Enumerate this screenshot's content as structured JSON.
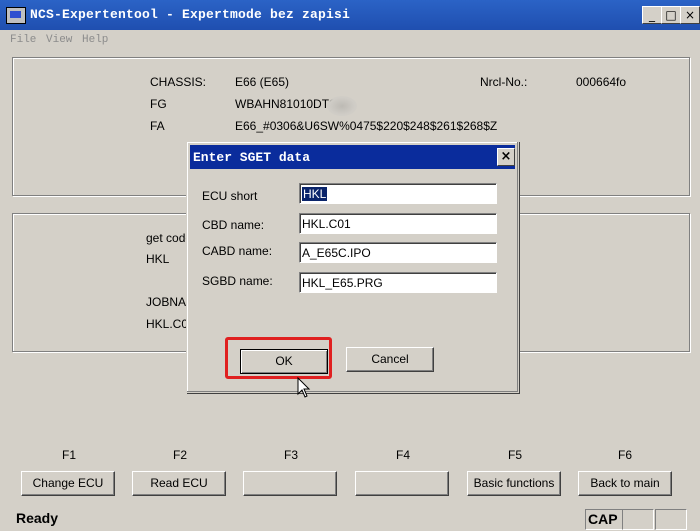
{
  "window": {
    "title": "NCS-Expertentool - Expertmode bez zapisi",
    "controls": {
      "minimize": "_",
      "maximize": "□",
      "close": "×"
    }
  },
  "menu": [
    "File",
    "View",
    "Help"
  ],
  "vehicle": {
    "chassis_label": "CHASSIS:",
    "chassis_value": "E66 (E65)",
    "nrcl_label": "Nrcl-No.:",
    "nrcl_value": "000664fo",
    "fg_label": "FG",
    "fg_value": "WBAHN81010DT2",
    "fa_label": "FA",
    "fa_value": "E66_#0306&U6SW%0475$220$248$261$268$Z"
  },
  "ecu_panel": {
    "get_code": "get code",
    "ecu": "HKL",
    "jobname": "JOBNAM",
    "file": "HKL.C0"
  },
  "function_keys": [
    {
      "key": "F1",
      "label": "Change ECU"
    },
    {
      "key": "F2",
      "label": "Read ECU"
    },
    {
      "key": "F3",
      "label": ""
    },
    {
      "key": "F4",
      "label": ""
    },
    {
      "key": "F5",
      "label": "Basic functions"
    },
    {
      "key": "F6",
      "label": "Back to main"
    }
  ],
  "status": {
    "text": "Ready",
    "cap": "CAP"
  },
  "dialog": {
    "title": "Enter SGET data",
    "close": "×",
    "fields": [
      {
        "label": "ECU short",
        "value": "HKL"
      },
      {
        "label": "CBD name:",
        "value": "HKL.C01"
      },
      {
        "label": "CABD name:",
        "value": "A_E65C.IPO"
      },
      {
        "label": "SGBD name:",
        "value": "HKL_E65.PRG"
      }
    ],
    "ok": "OK",
    "cancel": "Cancel",
    "highlight_color": "#e02020"
  }
}
